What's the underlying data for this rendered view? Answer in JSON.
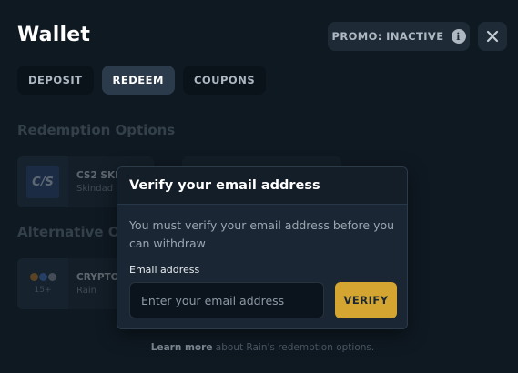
{
  "wallet": {
    "title": "Wallet",
    "promo_label": "PROMO: INACTIVE",
    "close_icon": "close-icon",
    "info_icon": "info-icon"
  },
  "tabs": [
    {
      "label": "DEPOSIT",
      "active": false
    },
    {
      "label": "REDEEM",
      "active": true
    },
    {
      "label": "COUPONS",
      "active": false
    }
  ],
  "redemption": {
    "section_title": "Redemption Options",
    "options": [
      {
        "name": "CS2 SKI",
        "sub": "Skindad",
        "logo_text": "C/S"
      }
    ]
  },
  "alternative": {
    "section_title": "Alternative Op",
    "options": [
      {
        "name": "CRYPTO",
        "sub": "Rain",
        "count": "15+"
      }
    ]
  },
  "footer": {
    "link": "Learn more",
    "text": " about Rain's redemption options."
  },
  "modal": {
    "title": "Verify your email address",
    "message": "You must verify your email address before you can withdraw",
    "email_label": "Email address",
    "email_value": "",
    "email_placeholder": "Enter your email address",
    "verify_label": "VERIFY"
  },
  "colors": {
    "background": "#0f1922",
    "accent": "#d4a531",
    "modal_bg": "#1a2633"
  }
}
